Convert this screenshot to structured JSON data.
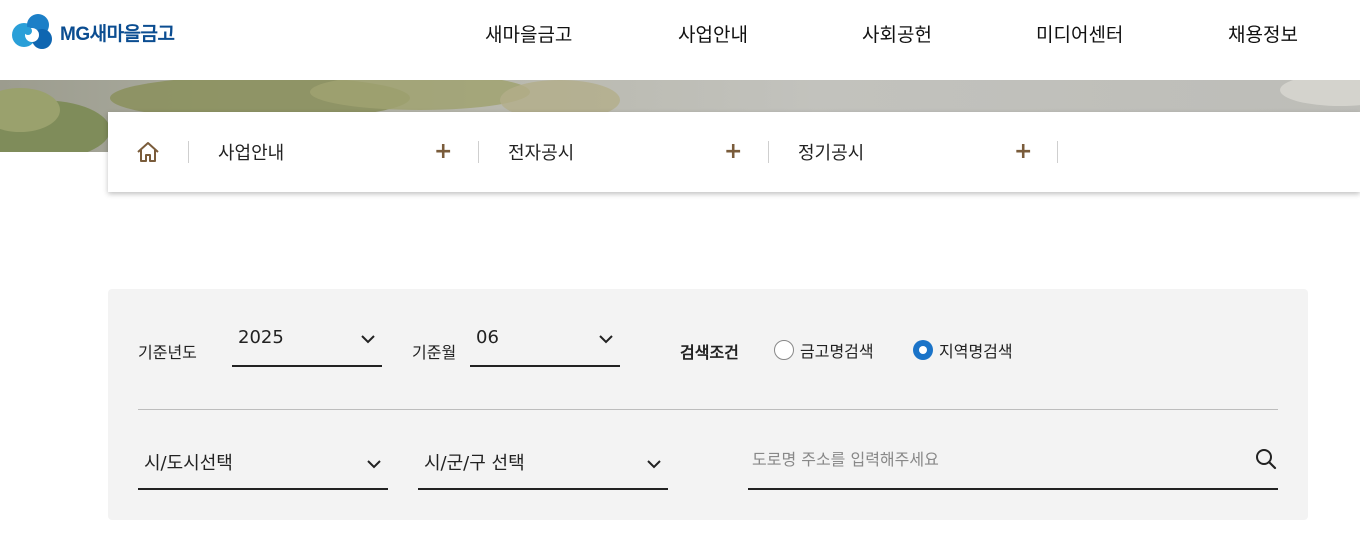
{
  "header": {
    "logo_text": "MG새마을금고",
    "nav": [
      {
        "label": "새마을금고"
      },
      {
        "label": "사업안내"
      },
      {
        "label": "사회공헌"
      },
      {
        "label": "미디어센터"
      },
      {
        "label": "채용정보"
      }
    ]
  },
  "breadcrumb": {
    "home_icon": "home-icon",
    "items": [
      {
        "label": "사업안내"
      },
      {
        "label": "전자공시"
      },
      {
        "label": "정기공시"
      }
    ],
    "plus_symbol": "+"
  },
  "search": {
    "year_label": "기준년도",
    "year_value": "2025",
    "month_label": "기준월",
    "month_value": "06",
    "condition_label": "검색조건",
    "radio_options": [
      {
        "label": "금고명검색",
        "checked": false
      },
      {
        "label": "지역명검색",
        "checked": true
      }
    ],
    "city_select": "시/도시선택",
    "district_select": "시/군/구 선택",
    "address_placeholder": "도로명 주소를 입력해주세요",
    "search_icon": "search-icon"
  },
  "colors": {
    "brand_blue": "#0b4d91",
    "radio_active": "#1a73c8",
    "plus_brown": "#7a5c3b",
    "panel_bg": "#f3f3f3"
  }
}
